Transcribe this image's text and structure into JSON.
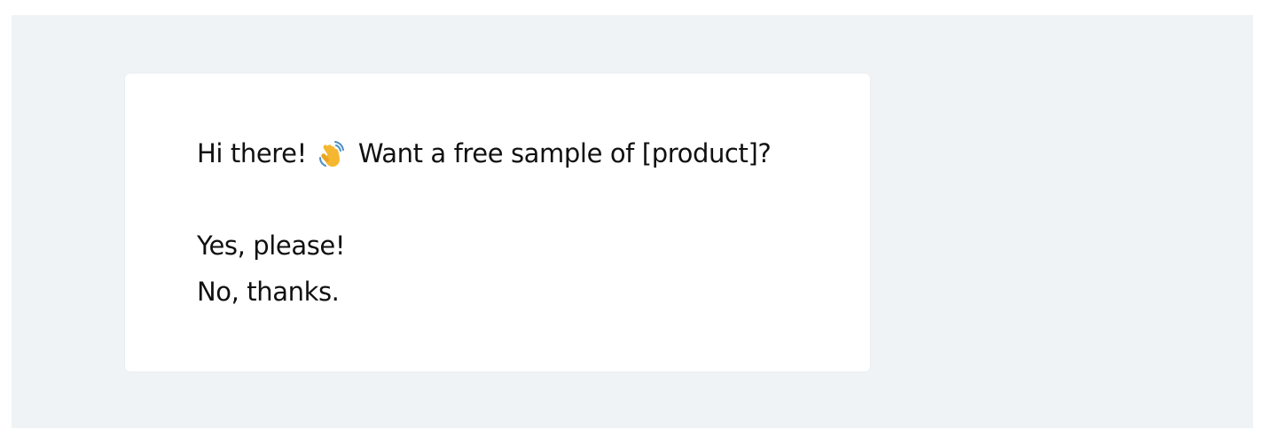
{
  "message": {
    "text_before_icon": "Hi there!",
    "icon": "waving-hand-icon",
    "text_after_icon": "Want a free sample of [product]?"
  },
  "options": [
    {
      "label": "Yes, please!"
    },
    {
      "label": "No, thanks."
    }
  ],
  "colors": {
    "page_background": "#f0f3f6",
    "card_background": "#ffffff",
    "text": "#111111",
    "icon_primary": "#f5b731"
  }
}
